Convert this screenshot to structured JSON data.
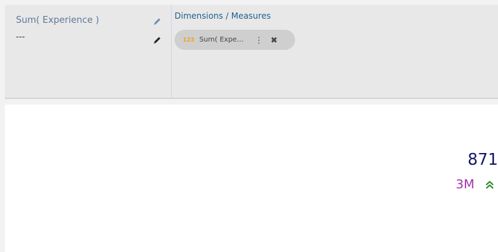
{
  "config": {
    "measure_title": "Sum( Experience )",
    "measure_value": "---",
    "dimensions_title": "Dimensions / Measures",
    "chip": {
      "type_label": "123",
      "label": "Sum( Expe..."
    }
  },
  "preview": {
    "kpi_value": "871",
    "kpi_sub_value": "3M",
    "trend": "up"
  },
  "colors": {
    "accent": "#1f5f8b",
    "kpi_value": "#151565",
    "kpi_sub_value": "#a232b0",
    "trend_up": "#2e8b2e",
    "type_badge": "#f0a020"
  },
  "icons": {
    "edit": "pencil-icon",
    "menu": "kebab-menu-icon",
    "remove": "close-icon",
    "trend": "double-chevron-up-icon"
  }
}
